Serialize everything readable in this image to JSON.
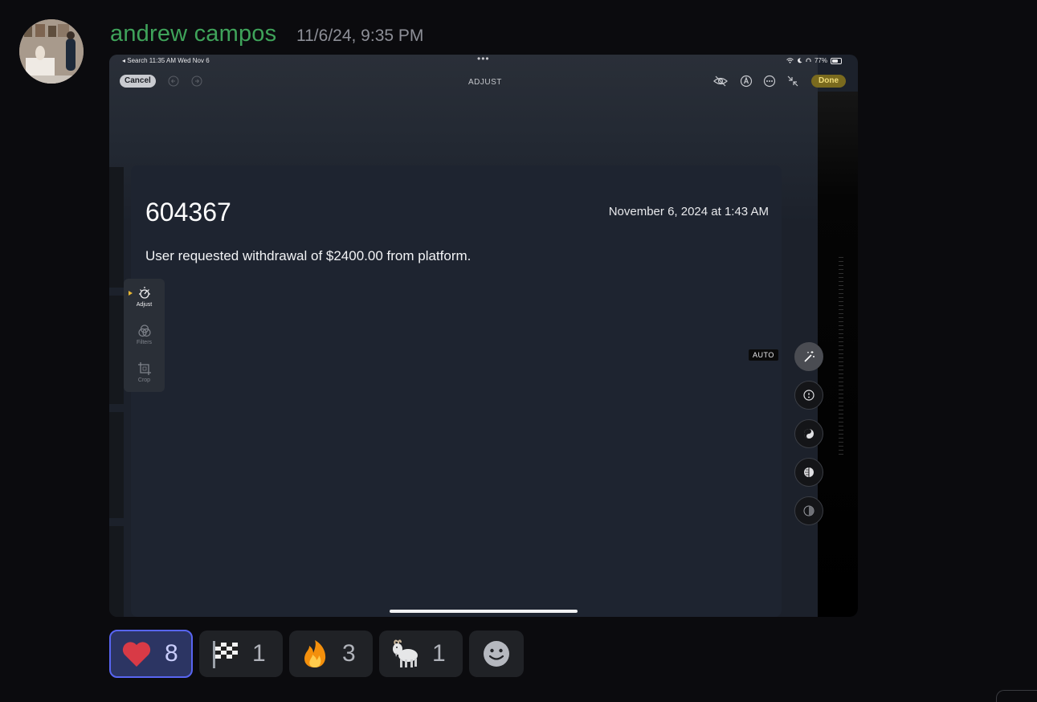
{
  "message": {
    "author": "andrew campos",
    "timestamp": "11/6/24, 9:35 PM",
    "author_color": "#3fa35a"
  },
  "attachment": {
    "statusbar": {
      "left": "◂ Search  11:35 AM  Wed Nov 6",
      "battery": "77%"
    },
    "toolbar": {
      "cancel_label": "Cancel",
      "title": "ADJUST",
      "done_label": "Done"
    },
    "card": {
      "number": "604367",
      "date": "November 6, 2024 at 1:43 AM",
      "message": "User requested withdrawal of $2400.00 from platform."
    },
    "side_panel": [
      {
        "label": "Adjust",
        "icon": "adjust-icon",
        "active": true
      },
      {
        "label": "Filters",
        "icon": "filters-icon",
        "active": false
      },
      {
        "label": "Crop",
        "icon": "crop-icon",
        "active": false
      }
    ],
    "auto_label": "AUTO",
    "adjust_tools": [
      "auto-enhance-icon",
      "exposure-icon",
      "brilliance-icon",
      "highlights-icon",
      "shadows-icon"
    ]
  },
  "reactions": [
    {
      "emoji": "heart-emoji",
      "count": "8",
      "active": true
    },
    {
      "emoji": "checkered-flag-emoji",
      "count": "1",
      "active": false
    },
    {
      "emoji": "fire-emoji",
      "count": "3",
      "active": false
    },
    {
      "emoji": "goat-emoji",
      "count": "1",
      "active": false
    },
    {
      "emoji": "add-reaction-icon",
      "count": "",
      "active": false
    }
  ],
  "colors": {
    "background": "#0b0b0e",
    "accent": "#5865f2",
    "done_button": "#7a6a1e",
    "active_arrow": "#e7b634"
  }
}
